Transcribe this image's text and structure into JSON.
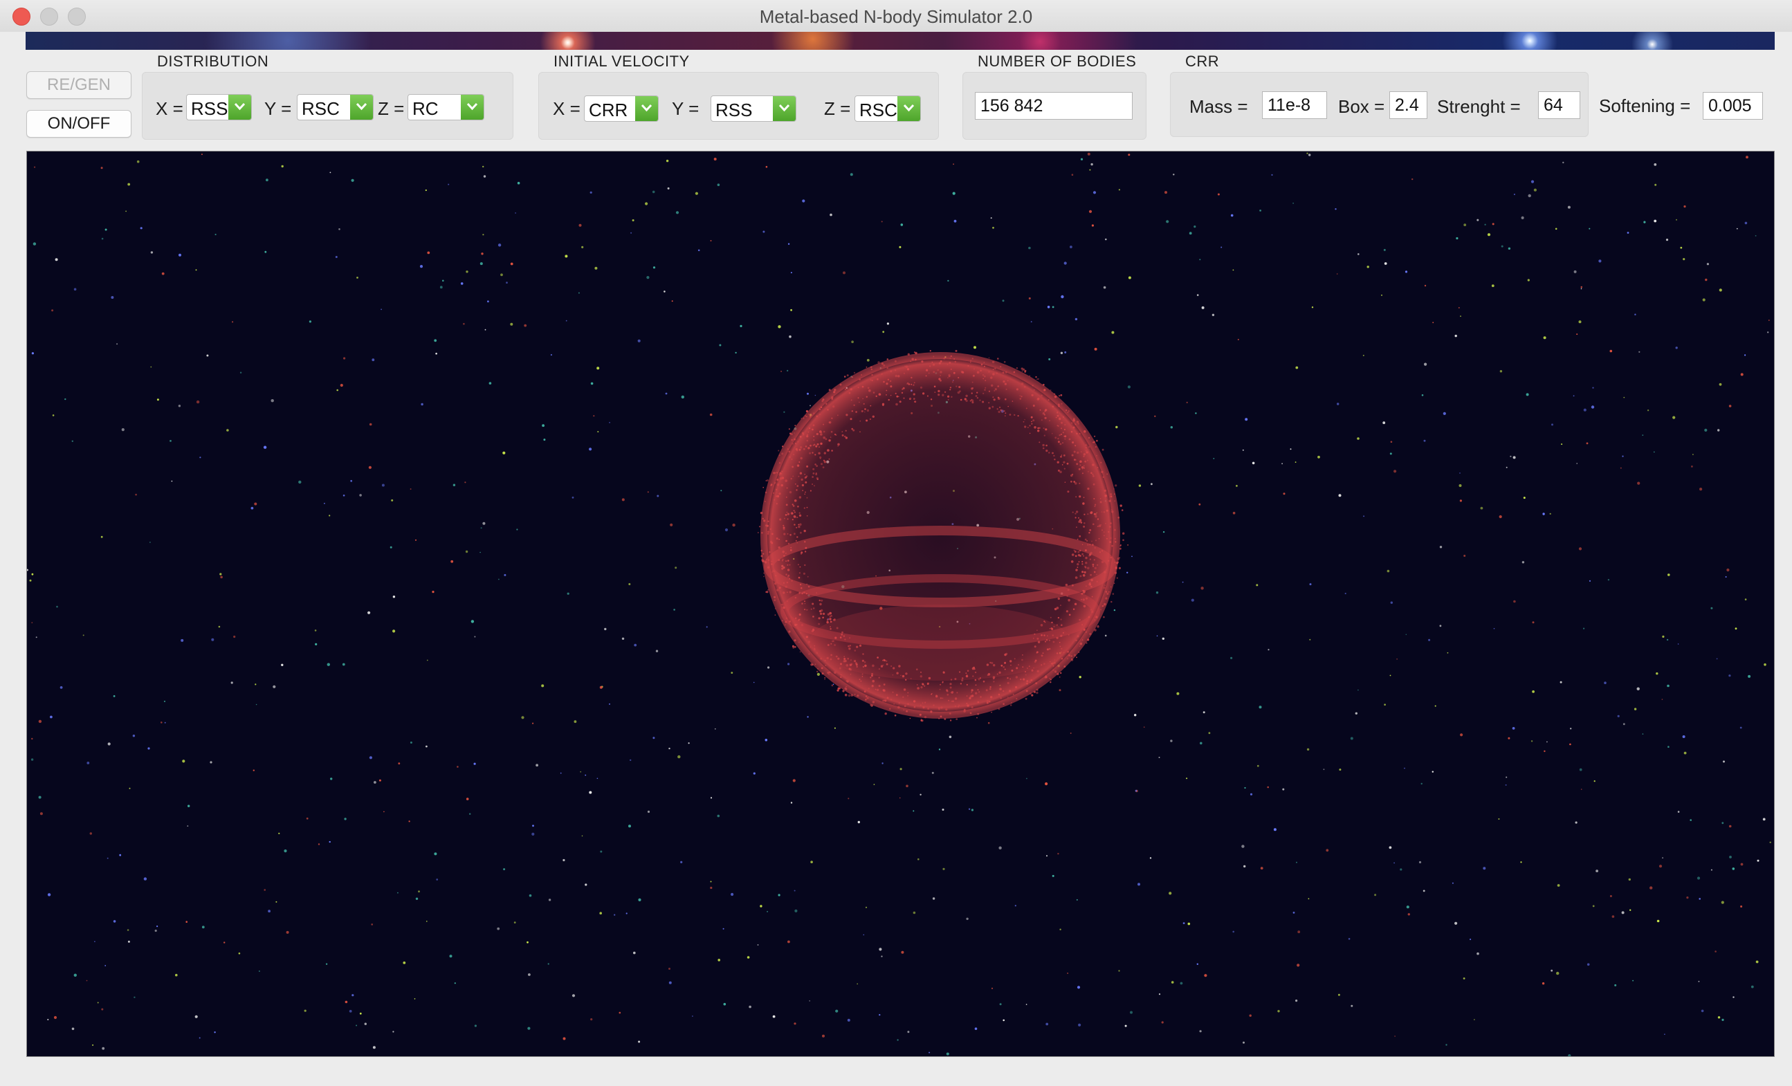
{
  "window": {
    "title": "Metal-based N-body Simulator 2.0"
  },
  "buttons": {
    "regen": "RE/GEN",
    "onoff": "ON/OFF"
  },
  "distribution": {
    "label": "DISTRIBUTION",
    "x_label": "X =",
    "x_value": "RSS",
    "y_label": "Y =",
    "y_value": "RSC",
    "z_label": "Z =",
    "z_value": "RC"
  },
  "initial_velocity": {
    "label": "INITIAL VELOCITY",
    "x_label": "X =",
    "x_value": "CRR",
    "y_label": "Y =",
    "y_value": "RSS",
    "z_label": "Z =",
    "z_value": "RSC"
  },
  "bodies": {
    "label": "NUMBER OF BODIES",
    "value": "156 842"
  },
  "crr": {
    "label": "CRR",
    "mass_label": "Mass =",
    "mass_value": "11e-8",
    "box_label": "Box =",
    "box_value": "2.4",
    "strength_label": "Strenght =",
    "strength_value": "64"
  },
  "softening": {
    "label": "Softening =",
    "value": "0.005"
  },
  "colors": {
    "canvas_bg": "#06061d",
    "sphere": "#d9474a",
    "stars": [
      "#c8e64a",
      "#e0523f",
      "#6a7bff",
      "#e8e8e8",
      "#3fb0a0"
    ],
    "dropdown_accent": "#5cb535"
  },
  "icons": {
    "dropdown": "chevron-down-icon"
  }
}
